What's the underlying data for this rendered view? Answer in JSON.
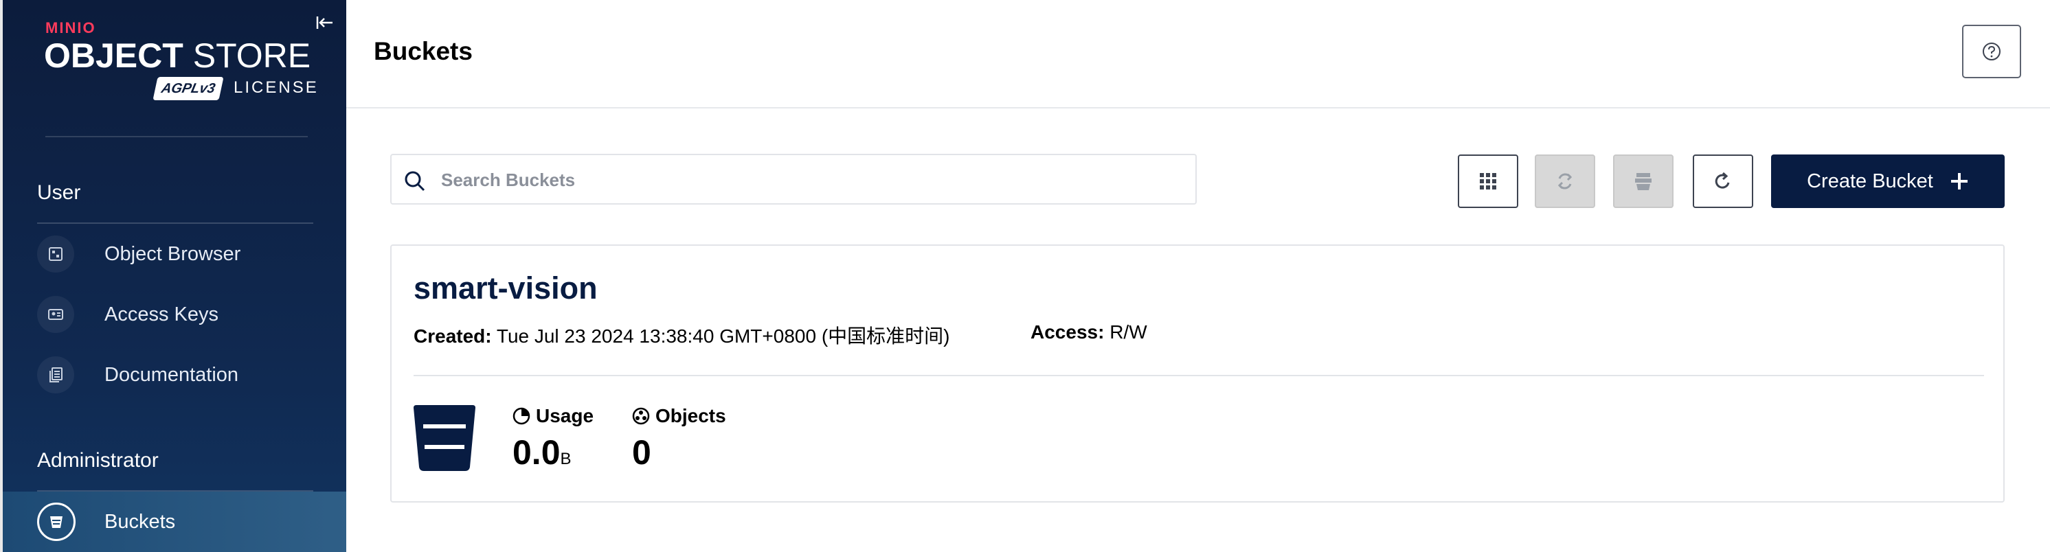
{
  "brand": {
    "logo_text": "MINIO",
    "title_bold": "OBJECT",
    "title_light": "STORE",
    "badge": "AGPLv3",
    "license": "LICENSE"
  },
  "sidebar": {
    "sections": [
      {
        "label": "User",
        "items": [
          {
            "label": "Object Browser",
            "icon": "object-browser-icon"
          },
          {
            "label": "Access Keys",
            "icon": "access-keys-icon"
          },
          {
            "label": "Documentation",
            "icon": "documentation-icon"
          }
        ]
      },
      {
        "label": "Administrator",
        "items": [
          {
            "label": "Buckets",
            "icon": "bucket-icon",
            "active": true
          }
        ]
      }
    ]
  },
  "header": {
    "title": "Buckets",
    "help_icon": "help-icon"
  },
  "toolbar": {
    "search": {
      "placeholder": "Search Buckets",
      "value": ""
    },
    "buttons": [
      {
        "name": "grid-view",
        "icon": "grid-icon",
        "enabled": true
      },
      {
        "name": "replication",
        "icon": "replication-icon",
        "enabled": false
      },
      {
        "name": "bulk-delete",
        "icon": "stack-icon",
        "enabled": false
      },
      {
        "name": "refresh",
        "icon": "refresh-icon",
        "enabled": true
      }
    ],
    "create_label": "Create Bucket"
  },
  "bucket": {
    "name": "smart-vision",
    "created_label": "Created:",
    "created_value": "Tue Jul 23 2024 13:38:40 GMT+0800 (中国标准时间)",
    "access_label": "Access:",
    "access_value": "R/W",
    "usage_label": "Usage",
    "usage_value": "0.0",
    "usage_unit": "B",
    "objects_label": "Objects",
    "objects_value": "0"
  },
  "colors": {
    "sidebar_dark": "#0c1c3c",
    "sidebar_active": "#2f5f87",
    "brand_red": "#ff3b5c",
    "primary_navy": "#081c42",
    "disabled_gray": "#d8d8d8"
  }
}
